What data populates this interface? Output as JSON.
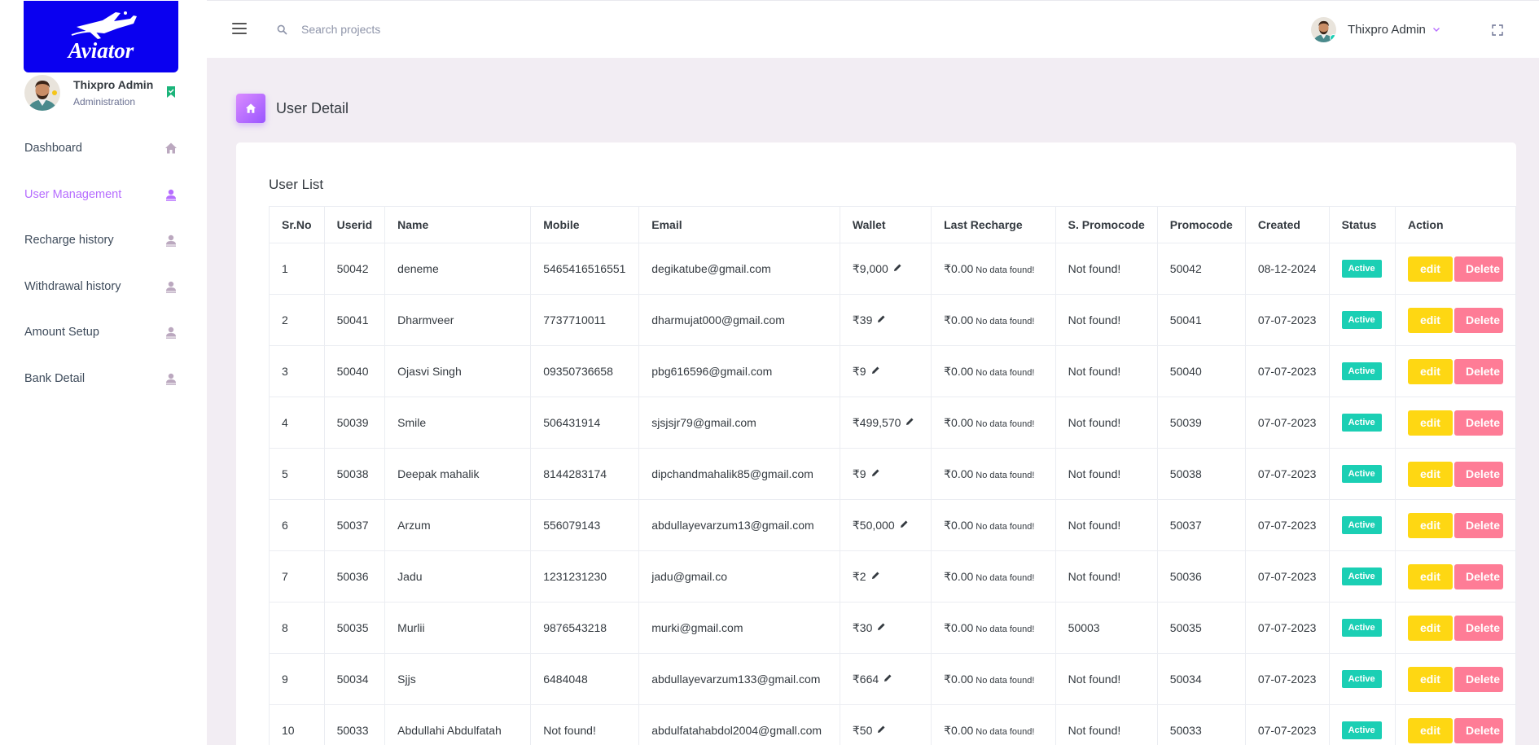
{
  "app": {
    "logo_text": "Aviator",
    "colors": {
      "accent": "#b66dff",
      "logo_bg": "#0a00f0",
      "active_badge": "#1bcfb4",
      "edit": "#fed713",
      "delete": "#fe7c96"
    }
  },
  "sidebar": {
    "profile": {
      "name": "Thixpro Admin",
      "role": "Administration",
      "status_icon": "bookmark-check-icon"
    },
    "items": [
      {
        "label": "Dashboard",
        "icon": "home-icon",
        "active": false
      },
      {
        "label": "User Management",
        "icon": "user-icon",
        "active": true
      },
      {
        "label": "Recharge history",
        "icon": "user-icon",
        "active": false
      },
      {
        "label": "Withdrawal history",
        "icon": "user-icon",
        "active": false
      },
      {
        "label": "Amount Setup",
        "icon": "user-icon",
        "active": false
      },
      {
        "label": "Bank Detail",
        "icon": "user-icon",
        "active": false
      }
    ]
  },
  "header": {
    "search": {
      "placeholder": "Search projects",
      "value": ""
    },
    "user_name": "Thixpro Admin"
  },
  "main": {
    "page_title": "User Detail",
    "card_title": "User List",
    "columns": [
      "Sr.No",
      "Userid",
      "Name",
      "Mobile",
      "Email",
      "Wallet",
      "Last Recharge",
      "S. Promocode",
      "Promocode",
      "Created",
      "Status",
      "Action"
    ],
    "rows": [
      {
        "sr": "1",
        "userid": "50042",
        "name": "deneme",
        "mobile": "5465416516551",
        "email": "degikatube@gmail.com",
        "wallet": "₹9,000",
        "last_recharge": "₹0.00",
        "last_recharge_note": "No data found!",
        "s_promocode": "Not found!",
        "promocode": "50042",
        "created": "08-12-2024",
        "status": "Active",
        "edit": "edit",
        "delete": "Delete"
      },
      {
        "sr": "2",
        "userid": "50041",
        "name": "Dharmveer",
        "mobile": "7737710011",
        "email": "dharmujat000@gmail.com",
        "wallet": "₹39",
        "last_recharge": "₹0.00",
        "last_recharge_note": "No data found!",
        "s_promocode": "Not found!",
        "promocode": "50041",
        "created": "07-07-2023",
        "status": "Active",
        "edit": "edit",
        "delete": "Delete"
      },
      {
        "sr": "3",
        "userid": "50040",
        "name": "Ojasvi Singh",
        "mobile": "09350736658",
        "email": "pbg616596@gmail.com",
        "wallet": "₹9",
        "last_recharge": "₹0.00",
        "last_recharge_note": "No data found!",
        "s_promocode": "Not found!",
        "promocode": "50040",
        "created": "07-07-2023",
        "status": "Active",
        "edit": "edit",
        "delete": "Delete"
      },
      {
        "sr": "4",
        "userid": "50039",
        "name": "Smile",
        "mobile": "506431914",
        "email": "sjsjsjr79@gmail.com",
        "wallet": "₹499,570",
        "last_recharge": "₹0.00",
        "last_recharge_note": "No data found!",
        "s_promocode": "Not found!",
        "promocode": "50039",
        "created": "07-07-2023",
        "status": "Active",
        "edit": "edit",
        "delete": "Delete"
      },
      {
        "sr": "5",
        "userid": "50038",
        "name": "Deepak mahalik",
        "mobile": "8144283174",
        "email": "dipchandmahalik85@gmail.com",
        "wallet": "₹9",
        "last_recharge": "₹0.00",
        "last_recharge_note": "No data found!",
        "s_promocode": "Not found!",
        "promocode": "50038",
        "created": "07-07-2023",
        "status": "Active",
        "edit": "edit",
        "delete": "Delete"
      },
      {
        "sr": "6",
        "userid": "50037",
        "name": "Arzum",
        "mobile": "556079143",
        "email": "abdullayevarzum13@gmail.com",
        "wallet": "₹50,000",
        "last_recharge": "₹0.00",
        "last_recharge_note": "No data found!",
        "s_promocode": "Not found!",
        "promocode": "50037",
        "created": "07-07-2023",
        "status": "Active",
        "edit": "edit",
        "delete": "Delete"
      },
      {
        "sr": "7",
        "userid": "50036",
        "name": "Jadu",
        "mobile": "1231231230",
        "email": "jadu@gmail.co",
        "wallet": "₹2",
        "last_recharge": "₹0.00",
        "last_recharge_note": "No data found!",
        "s_promocode": "Not found!",
        "promocode": "50036",
        "created": "07-07-2023",
        "status": "Active",
        "edit": "edit",
        "delete": "Delete"
      },
      {
        "sr": "8",
        "userid": "50035",
        "name": "Murlii",
        "mobile": "9876543218",
        "email": "murki@gmail.com",
        "wallet": "₹30",
        "last_recharge": "₹0.00",
        "last_recharge_note": "No data found!",
        "s_promocode": "50003",
        "promocode": "50035",
        "created": "07-07-2023",
        "status": "Active",
        "edit": "edit",
        "delete": "Delete"
      },
      {
        "sr": "9",
        "userid": "50034",
        "name": "Sjjs",
        "mobile": "6484048",
        "email": "abdullayevarzum133@gmail.com",
        "wallet": "₹664",
        "last_recharge": "₹0.00",
        "last_recharge_note": "No data found!",
        "s_promocode": "Not found!",
        "promocode": "50034",
        "created": "07-07-2023",
        "status": "Active",
        "edit": "edit",
        "delete": "Delete"
      },
      {
        "sr": "10",
        "userid": "50033",
        "name": "Abdullahi Abdulfatah",
        "mobile": "Not found!",
        "email": "abdulfatahabdol2004@gmall.com",
        "wallet": "₹50",
        "last_recharge": "₹0.00",
        "last_recharge_note": "No data found!",
        "s_promocode": "Not found!",
        "promocode": "50033",
        "created": "07-07-2023",
        "status": "Active",
        "edit": "edit",
        "delete": "Delete"
      }
    ]
  }
}
